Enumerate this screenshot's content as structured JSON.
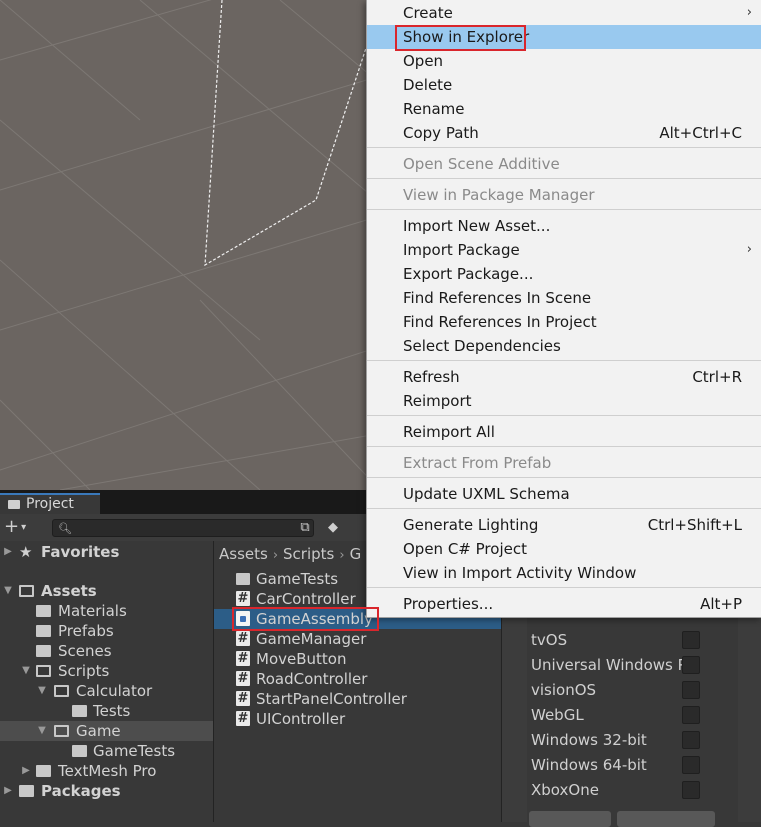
{
  "project_window": {
    "tab_label": "Project",
    "add_label": "+",
    "search": {
      "value": "",
      "placeholder": ""
    },
    "tree": [
      {
        "label": "Favorites",
        "bold": true
      },
      {
        "label": "Assets",
        "bold": true
      },
      {
        "label": "Materials"
      },
      {
        "label": "Prefabs"
      },
      {
        "label": "Scenes"
      },
      {
        "label": "Scripts"
      },
      {
        "label": "Calculator"
      },
      {
        "label": "Tests"
      },
      {
        "label": "Game",
        "selected": true
      },
      {
        "label": "GameTests"
      },
      {
        "label": "TextMesh Pro"
      },
      {
        "label": "Packages",
        "bold": true
      }
    ],
    "breadcrumb": [
      "Assets",
      "Scripts",
      "G"
    ],
    "files": [
      {
        "label": "GameTests",
        "icon": "folder-icon"
      },
      {
        "label": "CarController",
        "icon": "csharp-script-icon"
      },
      {
        "label": "GameAssembly",
        "icon": "assembly-definition-icon",
        "selected": true
      },
      {
        "label": "GameManager",
        "icon": "csharp-script-icon"
      },
      {
        "label": "MoveButton",
        "icon": "csharp-script-icon"
      },
      {
        "label": "RoadController",
        "icon": "csharp-script-icon"
      },
      {
        "label": "StartPanelController",
        "icon": "csharp-script-icon"
      },
      {
        "label": "UIController",
        "icon": "csharp-script-icon"
      }
    ]
  },
  "inspector": {
    "platforms": [
      "tvOS",
      "Universal Windows P",
      "visionOS",
      "WebGL",
      "Windows 32-bit",
      "Windows 64-bit",
      "XboxOne"
    ]
  },
  "context_menu": {
    "items": [
      {
        "label": "Create",
        "submenu": true
      },
      {
        "label": "Show in Explorer",
        "highlighted": true
      },
      {
        "label": "Open"
      },
      {
        "label": "Delete"
      },
      {
        "label": "Rename"
      },
      {
        "label": "Copy Path",
        "shortcut": "Alt+Ctrl+C"
      },
      {
        "label": "Open Scene Additive",
        "disabled": true
      },
      {
        "label": "View in Package Manager",
        "disabled": true
      },
      {
        "label": "Import New Asset..."
      },
      {
        "label": "Import Package",
        "submenu": true
      },
      {
        "label": "Export Package..."
      },
      {
        "label": "Find References In Scene"
      },
      {
        "label": "Find References In Project"
      },
      {
        "label": "Select Dependencies"
      },
      {
        "label": "Refresh",
        "shortcut": "Ctrl+R"
      },
      {
        "label": "Reimport"
      },
      {
        "label": "Reimport All"
      },
      {
        "label": "Extract From Prefab",
        "disabled": true
      },
      {
        "label": "Update UXML Schema"
      },
      {
        "label": "Generate Lighting",
        "shortcut": "Ctrl+Shift+L"
      },
      {
        "label": "Open C# Project"
      },
      {
        "label": "View in Import Activity Window"
      },
      {
        "label": "Properties...",
        "shortcut": "Alt+P"
      }
    ],
    "submenu_glyph": "›"
  },
  "colors": {
    "highlight": "#99c9ef",
    "annotation_red": "#d9262c",
    "selection_blue": "#2c5d87"
  }
}
